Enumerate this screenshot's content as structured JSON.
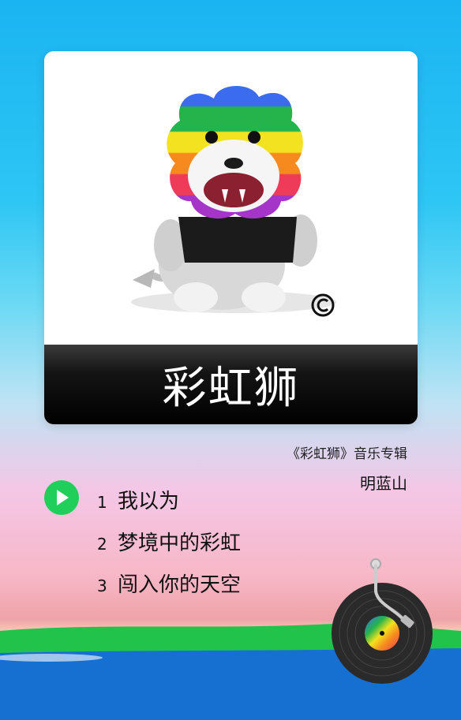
{
  "album": {
    "title": "彩虹狮",
    "subtitle": "《彩虹狮》音乐专辑",
    "artist": "明蓝山"
  },
  "tracks": [
    {
      "number": "1",
      "title": "我以为"
    },
    {
      "number": "2",
      "title": "梦境中的彩虹"
    },
    {
      "number": "3",
      "title": "闯入你的天空"
    }
  ],
  "icons": {
    "play": "play-icon",
    "copyright": "copyright-icon",
    "record": "vinyl-record-icon"
  },
  "colors": {
    "play_button": "#1fcf5a",
    "title_bar": "#000000",
    "grass": "#22c34a",
    "sea": "#1a73d6"
  }
}
